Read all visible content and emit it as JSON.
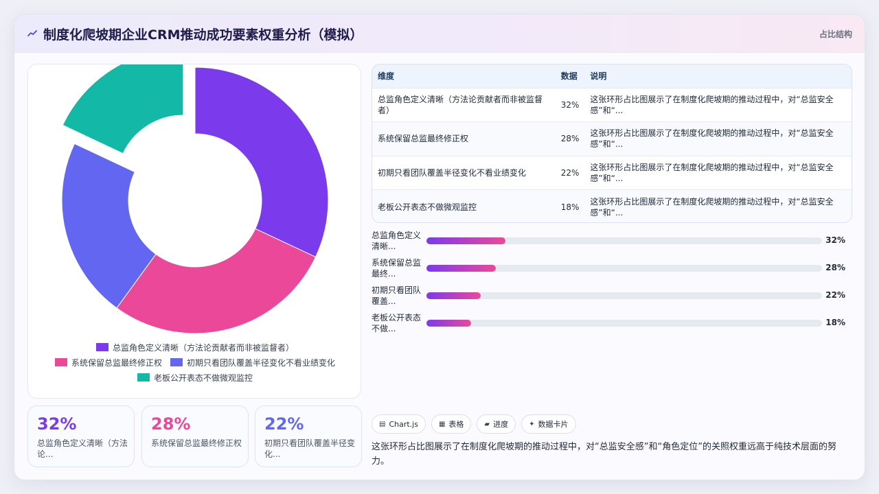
{
  "header": {
    "title": "制度化爬坡期企业CRM推动成功要素权重分析（模拟）",
    "tag": "占比结构"
  },
  "chart_data": {
    "type": "pie",
    "variant": "donut",
    "categories": [
      "总监角色定义清晰（方法论贡献者而非被监督者）",
      "系统保留总监最终修正权",
      "初期只看团队覆盖半径变化不看业绩变化",
      "老板公开表态不做微观监控"
    ],
    "values": [
      32,
      28,
      22,
      18
    ],
    "colors": [
      "#7c3aed",
      "#ec4899",
      "#6366f1",
      "#14b8a6"
    ],
    "exploded_index": 3,
    "legend_position": "bottom"
  },
  "kpis": [
    {
      "value": "32%",
      "label": "总监角色定义清晰（方法论...",
      "color": "#7c3aed"
    },
    {
      "value": "28%",
      "label": "系统保留总监最终修正权",
      "color": "#ec4899"
    },
    {
      "value": "22%",
      "label": "初期只看团队覆盖半径变化...",
      "color": "#6366f1"
    }
  ],
  "table": {
    "headers": [
      "维度",
      "数据",
      "说明"
    ],
    "rows": [
      [
        "总监角色定义清晰（方法论贡献者而非被监督者）",
        "32%",
        "这张环形占比图展示了在制度化爬坡期的推动过程中，对“总监安全感”和“..."
      ],
      [
        "系统保留总监最终修正权",
        "28%",
        "这张环形占比图展示了在制度化爬坡期的推动过程中，对“总监安全感”和“..."
      ],
      [
        "初期只看团队覆盖半径变化不看业绩变化",
        "22%",
        "这张环形占比图展示了在制度化爬坡期的推动过程中，对“总监安全感”和“..."
      ],
      [
        "老板公开表态不做微观监控",
        "18%",
        "这张环形占比图展示了在制度化爬坡期的推动过程中，对“总监安全感”和“..."
      ]
    ]
  },
  "bars": [
    {
      "label": "总监角色定义清晰...",
      "value": 0.2,
      "pct": "32%"
    },
    {
      "label": "系统保留总监最终...",
      "value": 0.175,
      "pct": "28%"
    },
    {
      "label": "初期只看团队覆盖...",
      "value": 0.138,
      "pct": "22%"
    },
    {
      "label": "老板公开表态不做...",
      "value": 0.113,
      "pct": "18%"
    }
  ],
  "chips": [
    {
      "icon": "▤",
      "label": "Chart.js"
    },
    {
      "icon": "▦",
      "label": "表格"
    },
    {
      "icon": "▰",
      "label": "进度"
    },
    {
      "icon": "✦",
      "label": "数据卡片"
    }
  ],
  "description": "这张环形占比图展示了在制度化爬坡期的推动过程中，对“总监安全感”和“角色定位”的关照权重远高于纯技术层面的努力。"
}
